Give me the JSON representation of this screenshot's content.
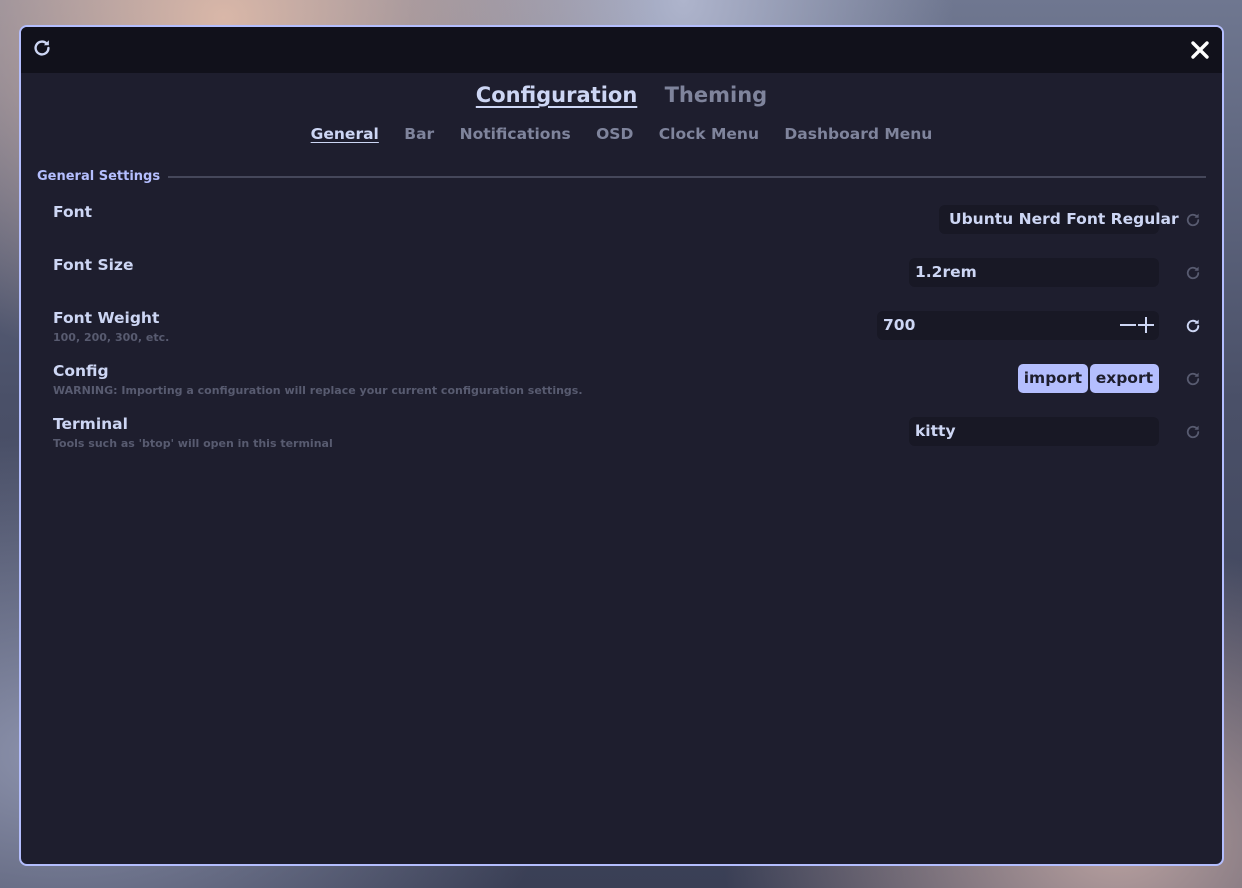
{
  "main_tabs": [
    {
      "label": "Configuration",
      "active": true
    },
    {
      "label": "Theming",
      "active": false
    }
  ],
  "sub_tabs": [
    {
      "label": "General",
      "active": true
    },
    {
      "label": "Bar",
      "active": false
    },
    {
      "label": "Notifications",
      "active": false
    },
    {
      "label": "OSD",
      "active": false
    },
    {
      "label": "Clock Menu",
      "active": false
    },
    {
      "label": "Dashboard Menu",
      "active": false
    }
  ],
  "section": {
    "title": "General Settings"
  },
  "settings": {
    "font": {
      "title": "Font",
      "value": "Ubuntu Nerd Font Regular"
    },
    "font_size": {
      "title": "Font Size",
      "value": "1.2rem"
    },
    "font_weight": {
      "title": "Font Weight",
      "subtitle": "100, 200, 300, etc.",
      "value": "700"
    },
    "config": {
      "title": "Config",
      "subtitle": "WARNING: Importing a configuration will replace your current configuration settings.",
      "import_label": "import",
      "export_label": "export"
    },
    "terminal": {
      "title": "Terminal",
      "subtitle": "Tools such as 'btop' will open in this terminal",
      "value": "kitty"
    }
  },
  "icons": {
    "titlebar_refresh": "refresh-icon",
    "titlebar_close": "close-icon",
    "row_reset": "reset-icon",
    "spin_minus": "minus-icon",
    "spin_plus": "plus-icon"
  },
  "colors": {
    "window_bg": "#1e1e2e",
    "titlebar_bg": "#11111b",
    "accent": "#b4befe",
    "text": "#cdd6f4",
    "muted": "#7f849c",
    "field_bg": "#181825"
  }
}
